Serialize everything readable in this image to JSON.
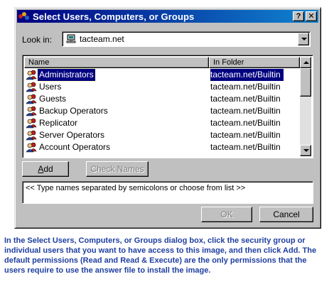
{
  "dialog": {
    "title": "Select Users, Computers, or Groups",
    "help_button": "?",
    "close_button": "✕",
    "title_gradient": [
      "#000080",
      "#1084d0"
    ]
  },
  "look_in": {
    "label": "Look in:",
    "value": "tacteam.net",
    "icon": "domain-computer-icon"
  },
  "list": {
    "columns": [
      "Name",
      "In Folder"
    ],
    "selected_index": 0,
    "rows": [
      {
        "name": "Administrators",
        "folder": "tacteam.net/Builtin",
        "icon": "group-icon"
      },
      {
        "name": "Users",
        "folder": "tacteam.net/Builtin",
        "icon": "group-icon"
      },
      {
        "name": "Guests",
        "folder": "tacteam.net/Builtin",
        "icon": "group-icon"
      },
      {
        "name": "Backup Operators",
        "folder": "tacteam.net/Builtin",
        "icon": "group-icon"
      },
      {
        "name": "Replicator",
        "folder": "tacteam.net/Builtin",
        "icon": "group-icon"
      },
      {
        "name": "Server Operators",
        "folder": "tacteam.net/Builtin",
        "icon": "group-icon"
      },
      {
        "name": "Account Operators",
        "folder": "tacteam.net/Builtin",
        "icon": "group-icon"
      }
    ]
  },
  "buttons": {
    "add": "Add",
    "check_names": "Check Names",
    "ok": "OK",
    "cancel": "Cancel"
  },
  "names_input": {
    "placeholder": "<< Type names separated by semicolons or choose from list >>"
  },
  "caption": "In the Select Users, Computers, or Groups dialog box, click the security group or individual users that you want to have access to this image, and then click Add. The default permissions (Read and Read & Execute) are the only permissions that the users require to use the answer file to install the image.",
  "colors": {
    "dialog_face": "#c0c0c0",
    "selection": "#000080",
    "caption_text": "#1f3fa0"
  }
}
